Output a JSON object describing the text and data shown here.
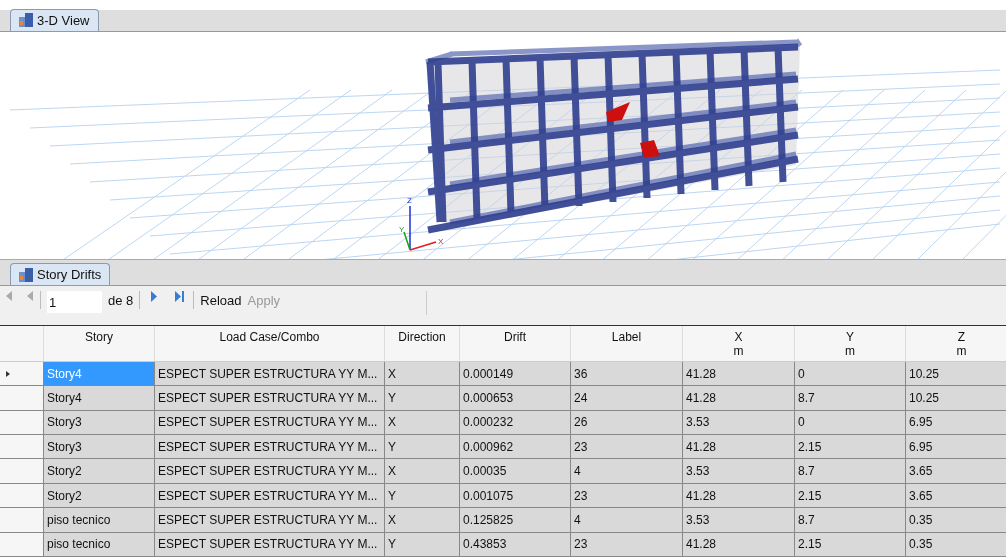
{
  "view_tab": {
    "label": "3-D View",
    "selected": true
  },
  "axes": [
    "Z",
    "Y",
    "X"
  ],
  "table_tab": {
    "label": "Story Drifts",
    "selected": true
  },
  "toolbar": {
    "page": "1",
    "page_count": "de 8",
    "reload": "Reload",
    "apply": "Apply",
    "apply_disabled": true
  },
  "table": {
    "columns": [
      {
        "label": "Story"
      },
      {
        "label": "Load Case/Combo"
      },
      {
        "label": "Direction"
      },
      {
        "label": "Drift"
      },
      {
        "label": "Label"
      },
      {
        "label": "X",
        "unit": "m"
      },
      {
        "label": "Y",
        "unit": "m"
      },
      {
        "label": "Z",
        "unit": "m"
      }
    ],
    "rows": [
      {
        "selected": true,
        "cells": [
          "Story4",
          "ESPECT SUPER ESTRUCTURA YY M...",
          "X",
          "0.000149",
          "36",
          "41.28",
          "0",
          "10.25"
        ]
      },
      {
        "selected": false,
        "cells": [
          "Story4",
          "ESPECT SUPER ESTRUCTURA YY M...",
          "Y",
          "0.000653",
          "24",
          "41.28",
          "8.7",
          "10.25"
        ]
      },
      {
        "selected": false,
        "cells": [
          "Story3",
          "ESPECT SUPER ESTRUCTURA YY M...",
          "X",
          "0.000232",
          "26",
          "3.53",
          "0",
          "6.95"
        ]
      },
      {
        "selected": false,
        "cells": [
          "Story3",
          "ESPECT SUPER ESTRUCTURA YY M...",
          "Y",
          "0.000962",
          "23",
          "41.28",
          "2.15",
          "6.95"
        ]
      },
      {
        "selected": false,
        "cells": [
          "Story2",
          "ESPECT SUPER ESTRUCTURA YY M...",
          "X",
          "0.00035",
          "4",
          "3.53",
          "8.7",
          "3.65"
        ]
      },
      {
        "selected": false,
        "cells": [
          "Story2",
          "ESPECT SUPER ESTRUCTURA YY M...",
          "Y",
          "0.001075",
          "23",
          "41.28",
          "2.15",
          "3.65"
        ]
      },
      {
        "selected": false,
        "cells": [
          "piso tecnico",
          "ESPECT SUPER ESTRUCTURA YY M...",
          "X",
          "0.125825",
          "4",
          "3.53",
          "8.7",
          "0.35"
        ]
      },
      {
        "selected": false,
        "cells": [
          "piso tecnico",
          "ESPECT SUPER ESTRUCTURA YY M...",
          "Y",
          "0.43853",
          "23",
          "41.28",
          "2.15",
          "0.35"
        ]
      }
    ]
  }
}
